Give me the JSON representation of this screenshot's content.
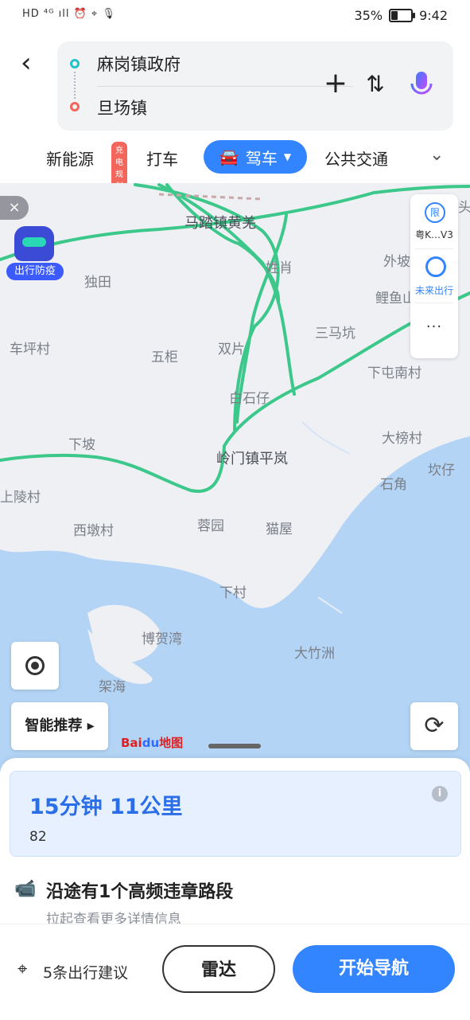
{
  "status_bar": {
    "left": "HD ⁴ᴳ ıll ⏰ ⌖ 🎙",
    "battery": "35%",
    "battery_level": 0.35,
    "time": "9:42"
  },
  "route": {
    "start": "麻岗镇政府",
    "end": "旦场镇"
  },
  "tabs": [
    {
      "label": "新能源",
      "badge": "充电规划"
    },
    {
      "label": "打车"
    },
    {
      "label": "驾车",
      "active": true
    },
    {
      "label": "公共交通"
    }
  ],
  "map": {
    "places": [
      "马踏镇黄羌",
      "姓肖",
      "外坡",
      "独田",
      "鲤鱼山",
      "车坪村",
      "五柜",
      "双片",
      "三马坑",
      "下屯南村",
      "白石仔",
      "下坡",
      "大榜村",
      "岭门镇平岚",
      "坎仔",
      "上陵村",
      "石角",
      "西墩村",
      "蓉园",
      "猫屋",
      "下村",
      "博贺湾",
      "大竹洲",
      "架海",
      "头"
    ],
    "close": "×",
    "covid_badge": "出行防疫",
    "restrict_icon": "限",
    "restrict_label": "粤K…V3",
    "future_label": "未来出行",
    "more": "···",
    "smart_recommend": "智能推荐 ▸",
    "refresh": "⟳",
    "logo": {
      "bai": "Bai",
      "du": "du",
      "tail": "地图"
    },
    "colors": {
      "road": "#3cc88a",
      "sea": "#b3d4f5",
      "land": "#eef0f4"
    }
  },
  "summary": {
    "time_distance": "15分钟  11公里",
    "route_code": "82",
    "info": "i"
  },
  "warning": {
    "title": "沿途有1个高频违章路段",
    "subtitle": "拉起查看更多详情信息"
  },
  "bottom": {
    "suggestions": "5条出行建议",
    "radar": "雷达",
    "start": "开始导航"
  }
}
